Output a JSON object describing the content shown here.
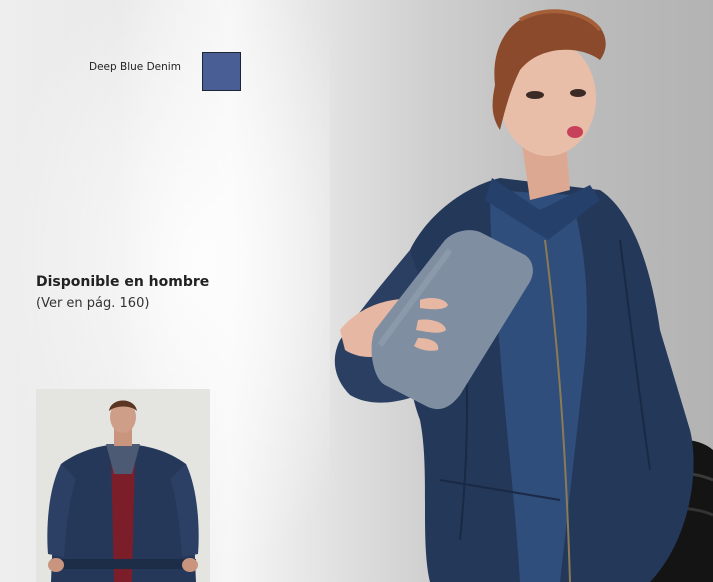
{
  "swatch": {
    "label": "Deep Blue Denim",
    "color": "#4a5e96"
  },
  "availability": {
    "title": "Disponible en hombre",
    "subtitle": "(Ver en pág. 160)"
  },
  "colors": {
    "denim": "#2b3f63",
    "denim_dark": "#1d2b45",
    "shirt": "#2f4e7c",
    "clutch": "#7f8fa1",
    "skin": "#e7b9a3",
    "hair": "#8a4a2b",
    "leather": "#141414"
  }
}
